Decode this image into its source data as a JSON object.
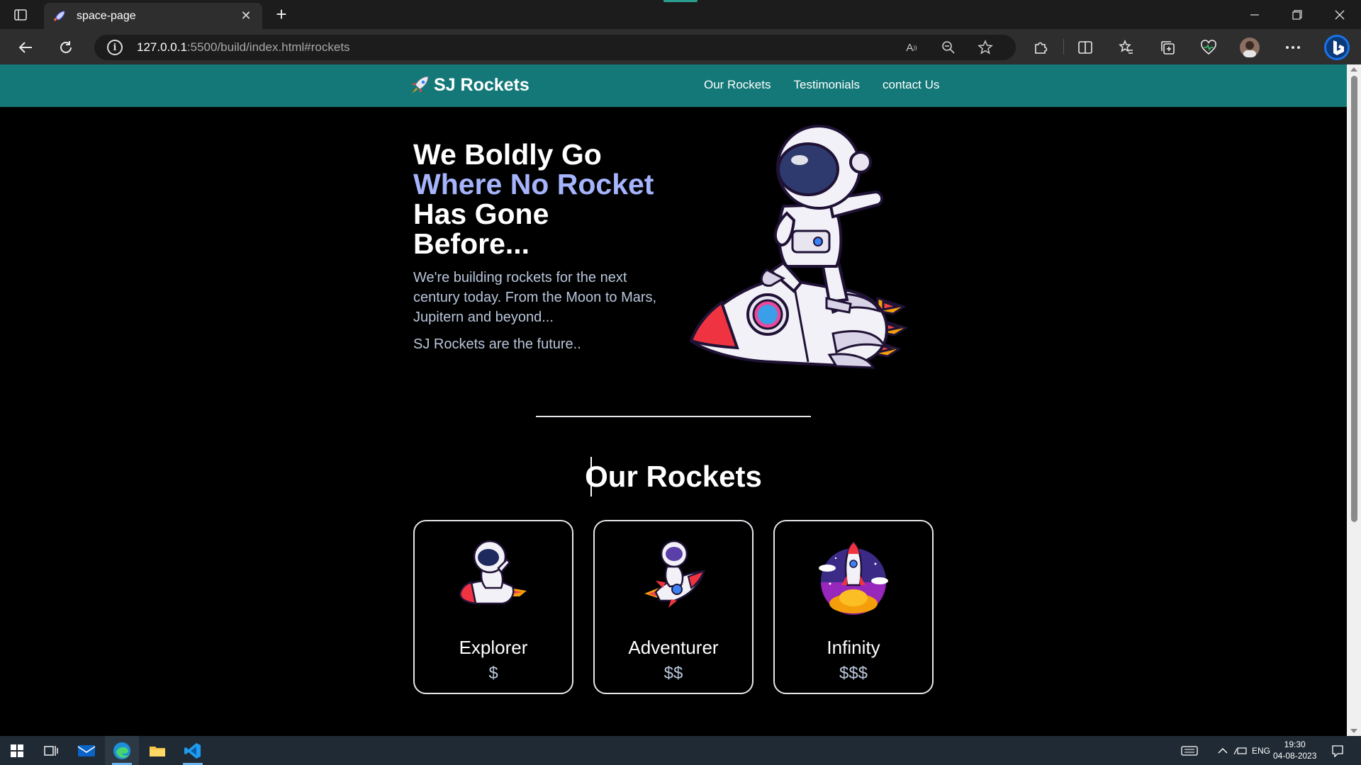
{
  "browser": {
    "tab_title": "space-page",
    "tab_close": "✕",
    "new_tab": "+",
    "url_host": "127.0.0.1",
    "url_path": ":5500/build/index.html#rockets",
    "read_aloud": "A",
    "read_aloud_sup": "))"
  },
  "nav": {
    "brand": "SJ Rockets",
    "links": [
      "Our Rockets",
      "Testimonials",
      "contact Us"
    ]
  },
  "hero": {
    "title_line1": "We Boldly Go",
    "title_highlight": "Where No Rocket",
    "title_line3": "Has Gone",
    "title_line4": "Before...",
    "description": "We're building rockets for the next century today. From the Moon to Mars, Jupitern and beyond...",
    "tagline": "SJ Rockets are the future.."
  },
  "rockets": {
    "heading": "Our Rockets",
    "cards": [
      {
        "name": "Explorer",
        "price": "$"
      },
      {
        "name": "Adventurer",
        "price": "$$"
      },
      {
        "name": "Infinity",
        "price": "$$$"
      }
    ]
  },
  "taskbar": {
    "lang": "ENG",
    "time": "19:30",
    "date": "04-08-2023"
  },
  "colors": {
    "navbar": "#147878",
    "highlight": "#a5b4fc",
    "muted_text": "#b8c6da"
  }
}
